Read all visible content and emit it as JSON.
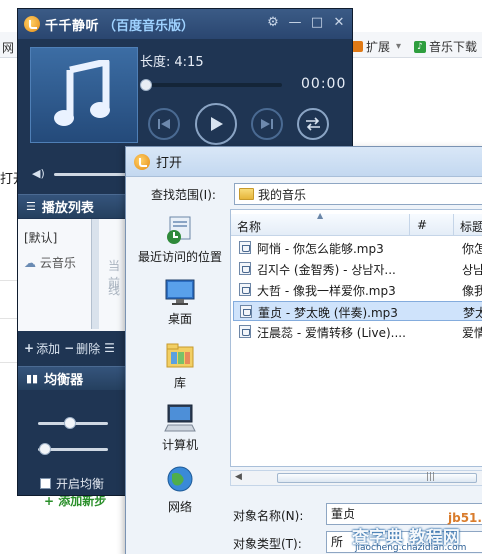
{
  "background": {
    "left_label": "网",
    "expand_label": "扩展",
    "music_download_label": "音乐下载",
    "open_fragment": "打开",
    "add_new": "+ 添加新步"
  },
  "player": {
    "title": "千千静听",
    "subtitle": "（百度音乐版）",
    "duration_label": "长度:",
    "duration_value": "4:15",
    "time_now": "00:00",
    "progress": 0,
    "colors": {
      "accent": "#1f3553",
      "title_highlight": "#9fd2ff"
    },
    "playlist": {
      "header": "播放列表",
      "default_item": "[默认]",
      "cloud_item": "云音乐",
      "hint_line1": "当前",
      "hint_line2": "线",
      "add_label": "添加",
      "delete_label": "删除"
    },
    "equalizer": {
      "header": "均衡器",
      "band_levels": [
        0.45,
        0.1
      ],
      "enable_label": "开启均衡"
    }
  },
  "dialog": {
    "title": "打开",
    "look_in_label": "查找范围(I):",
    "look_in_value": "我的音乐",
    "places": [
      {
        "label": "最近访问的位置",
        "icon": "recent-places-icon"
      },
      {
        "label": "桌面",
        "icon": "desktop-icon"
      },
      {
        "label": "库",
        "icon": "libraries-icon"
      },
      {
        "label": "计算机",
        "icon": "computer-icon"
      },
      {
        "label": "网络",
        "icon": "network-icon"
      }
    ],
    "columns": {
      "name": "名称",
      "number": "#",
      "title": "标题"
    },
    "files": [
      {
        "name": "阿悄 - 你怎么能够.mp3",
        "title": "你怎"
      },
      {
        "name": "김지수 (金智秀) - 상남자...",
        "title": "상남"
      },
      {
        "name": "大哲 - 像我一样爱你.mp3",
        "title": "像我"
      },
      {
        "name": "董贞 - 梦太晚 (伴奏).mp3",
        "title": "梦太"
      },
      {
        "name": "汪晨蕊 - 爱情转移 (Live)....",
        "title": "爱情"
      }
    ],
    "selected_index": 3,
    "filename_label": "对象名称(N):",
    "filename_value": "董贞",
    "filetype_label": "对象类型(T):",
    "filetype_value": "所"
  },
  "watermark": {
    "site": "jb51.net",
    "brand": "查字典 教程网",
    "url": "jiaocheng.chazidian.com"
  }
}
